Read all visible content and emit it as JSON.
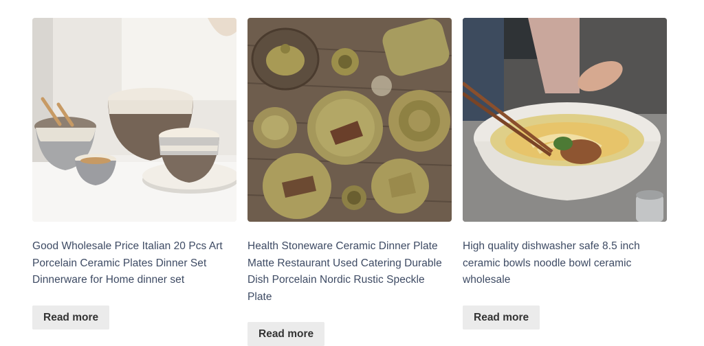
{
  "products": [
    {
      "title": "Good Wholesale Price Italian 20 Pcs Art Porcelain Ceramic Plates Dinner Set Dinnerware for Home dinner set",
      "button_label": "Read more",
      "image_icon": "tableware-set-photo"
    },
    {
      "title": "Health Stoneware Ceramic Dinner Plate Matte Restaurant Used Catering Durable Dish Porcelain Nordic Rustic Speckle Plate",
      "button_label": "Read more",
      "image_icon": "stoneware-plates-photo"
    },
    {
      "title": "High quality dishwasher safe 8.5 inch ceramic bowls noodle bowl ceramic wholesale",
      "button_label": "Read more",
      "image_icon": "noodle-bowl-photo"
    }
  ],
  "colors": {
    "title_text": "#3d4a63",
    "button_bg": "#ebebeb",
    "button_text": "#333333"
  }
}
